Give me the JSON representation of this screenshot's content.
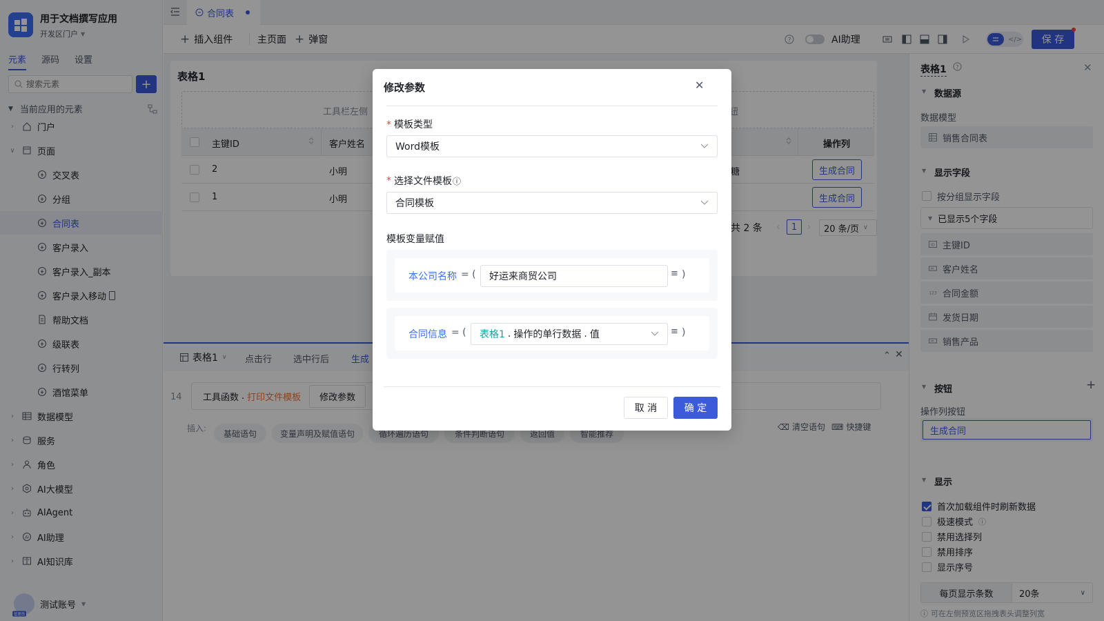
{
  "app": {
    "name": "用于文档撰写应用",
    "portal": "开发区门户",
    "tabs": [
      "元素",
      "源码",
      "设置"
    ],
    "search_placeholder": "搜索元素",
    "section_title": "当前应用的元素",
    "user": "测试账号",
    "user_badge": "管理员"
  },
  "tree": [
    {
      "label": "门户",
      "icon": "home-icon",
      "level": 0,
      "chev": "right"
    },
    {
      "label": "页面",
      "icon": "page-icon",
      "level": 0,
      "chev": "down"
    },
    {
      "label": "交叉表",
      "icon": "page-item-icon",
      "level": 1
    },
    {
      "label": "分组",
      "icon": "page-item-icon",
      "level": 1
    },
    {
      "label": "合同表",
      "icon": "page-item-icon",
      "level": 1,
      "active": true
    },
    {
      "label": "客户录入",
      "icon": "page-item-icon",
      "level": 1
    },
    {
      "label": "客户录入_副本",
      "icon": "page-item-icon",
      "level": 1
    },
    {
      "label": "客户录入移动",
      "icon": "page-item-icon",
      "level": 1
    },
    {
      "label": "帮助文档",
      "icon": "doc-icon",
      "level": 1
    },
    {
      "label": "级联表",
      "icon": "page-item-icon",
      "level": 1
    },
    {
      "label": "行转列",
      "icon": "page-item-icon",
      "level": 1
    },
    {
      "label": "酒馆菜单",
      "icon": "page-item-icon",
      "level": 1
    },
    {
      "label": "数据模型",
      "icon": "table-icon",
      "level": 0,
      "chev": "right"
    },
    {
      "label": "服务",
      "icon": "service-icon",
      "level": 0,
      "chev": "right"
    },
    {
      "label": "角色",
      "icon": "role-icon",
      "level": 0,
      "chev": "right"
    },
    {
      "label": "AI大模型",
      "icon": "ai-model-icon",
      "level": 0,
      "chev": "right"
    },
    {
      "label": "AIAgent",
      "icon": "robot-icon",
      "level": 0,
      "chev": "right"
    },
    {
      "label": "AI助理",
      "icon": "ai-assistant-icon",
      "level": 0,
      "chev": "right"
    },
    {
      "label": "AI知识库",
      "icon": "book-icon",
      "level": 0,
      "chev": "right"
    }
  ],
  "editor": {
    "open_tab": "合同表",
    "toolbar": {
      "insert": "插入组件",
      "main_page": "主页面",
      "popup": "弹窗",
      "ai": "AI助理",
      "save": "保 存"
    }
  },
  "canvas": {
    "component_title": "表格1",
    "toolbar_left": "工具栏左侧",
    "toolbar_right": "按钮",
    "columns": [
      "主键ID",
      "客户姓名",
      "品",
      "操作列"
    ],
    "rows": [
      {
        "id": "2",
        "name": "小明",
        "product": "奶糖",
        "action": "生成合同"
      },
      {
        "id": "1",
        "name": "小明",
        "product": "",
        "action": "生成合同"
      }
    ],
    "total": "共 2 条",
    "page": "1",
    "page_size": "20 条/页"
  },
  "bottom": {
    "component": "表格1",
    "tabs": [
      "点击行",
      "选中行后",
      "生成"
    ],
    "line_no": "14",
    "code_obj": "工具函数",
    "code_fn": "打印文件模板",
    "edit_params": "修改参数",
    "insert_label": "插入:",
    "pills": [
      "基础语句",
      "变量声明及赋值语句",
      "循环遍历语句",
      "条件判断语句",
      "返回值",
      "智能推荐"
    ],
    "clear": "清空语句",
    "shortcut": "快捷键"
  },
  "props": {
    "title": "表格1",
    "datasource_section": "数据源",
    "data_model_label": "数据模型",
    "data_model_value": "销售合同表",
    "fields_section": "显示字段",
    "group_fields": "按分组显示字段",
    "shown_count": "已显示5个字段",
    "fields": [
      {
        "label": "主键ID",
        "icon": "id-icon"
      },
      {
        "label": "客户姓名",
        "icon": "text-field-icon"
      },
      {
        "label": "合同金额",
        "icon": "number-field-icon"
      },
      {
        "label": "发货日期",
        "icon": "date-field-icon"
      },
      {
        "label": "销售产品",
        "icon": "text-field-icon"
      }
    ],
    "buttons_section": "按钮",
    "action_col_label": "操作列按钮",
    "action_button": "生成合同",
    "display_section": "显示",
    "display_options": [
      {
        "label": "首次加载组件时刷新数据",
        "checked": true
      },
      {
        "label": "极速模式",
        "checked": false
      },
      {
        "label": "禁用选择列",
        "checked": false
      },
      {
        "label": "禁用排序",
        "checked": false
      },
      {
        "label": "显示序号",
        "checked": false
      }
    ],
    "per_page_label": "每页显示条数",
    "per_page_value": "20条",
    "hint": "可在左侧预览区拖拽表头调整列宽"
  },
  "dialog": {
    "title": "修改参数",
    "template_type_label": "模板类型",
    "template_type_value": "Word模板",
    "file_template_label": "选择文件模板",
    "file_template_value": "合同模板",
    "vars_label": "模板变量赋值",
    "var1_name": "本公司名称",
    "var1_value": "好运来商贸公司",
    "var2_name": "合同信息",
    "var2_obj": "表格1",
    "var2_attr": "操作的单行数据",
    "var2_field": "值",
    "cancel": "取 消",
    "confirm": "确 定"
  },
  "colors": {
    "accent": "#3b5bdb",
    "required": "#f53f3f",
    "func": "#f77234",
    "var": "#3b6ff5",
    "teal": "#14a3a3"
  }
}
